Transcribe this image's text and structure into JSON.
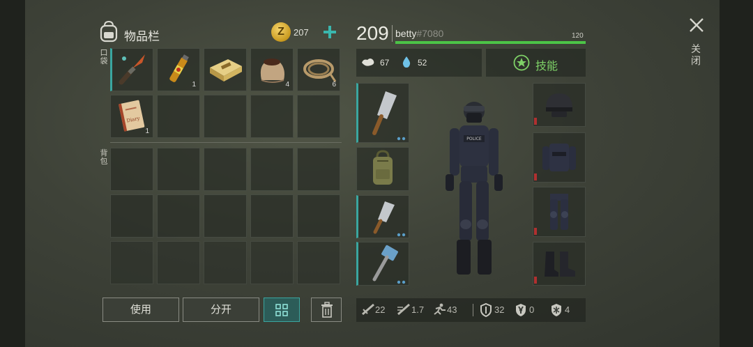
{
  "inventory": {
    "title": "物品栏",
    "coin_symbol": "Z",
    "coins": "207",
    "pocket_label": [
      "口",
      "袋"
    ],
    "backpack_label": [
      "背",
      "包"
    ],
    "pocket_items": [
      {
        "icon": "combat-knife-icon",
        "count": ""
      },
      {
        "icon": "vial-icon",
        "count": "1"
      },
      {
        "icon": "ammo-box-icon",
        "count": ""
      },
      {
        "icon": "sack-icon",
        "count": "4"
      },
      {
        "icon": "rope-icon",
        "count": "6"
      },
      {
        "icon": "diary-icon",
        "count": "1"
      }
    ],
    "diary_text": "Diary"
  },
  "actions": {
    "use": "使用",
    "split": "分开"
  },
  "player": {
    "level": "209",
    "name": "betty",
    "tag": "#7080",
    "xp_max": "120",
    "xp_fraction": 1.0,
    "hunger": "67",
    "thirst": "52",
    "skills_label": "技能"
  },
  "equipment": {
    "left": [
      "cleaver-icon",
      "backpack-icon",
      "cleaver-icon",
      "sledgehammer-icon"
    ],
    "right": [
      "helmet-icon",
      "police-vest-icon",
      "armored-pants-icon",
      "boots-icon"
    ],
    "vest_text": "POLICE"
  },
  "stats": {
    "damage": "22",
    "attack_speed": "1.7",
    "speed": "43",
    "armor": "32",
    "radiation": "0",
    "cold": "4"
  },
  "close": {
    "label": [
      "关",
      "闭"
    ]
  },
  "colors": {
    "accent_teal": "#3aa6a0",
    "xp_green": "#4cc447",
    "skill_green": "#7ed167",
    "coin_gold": "#e3b43a"
  }
}
